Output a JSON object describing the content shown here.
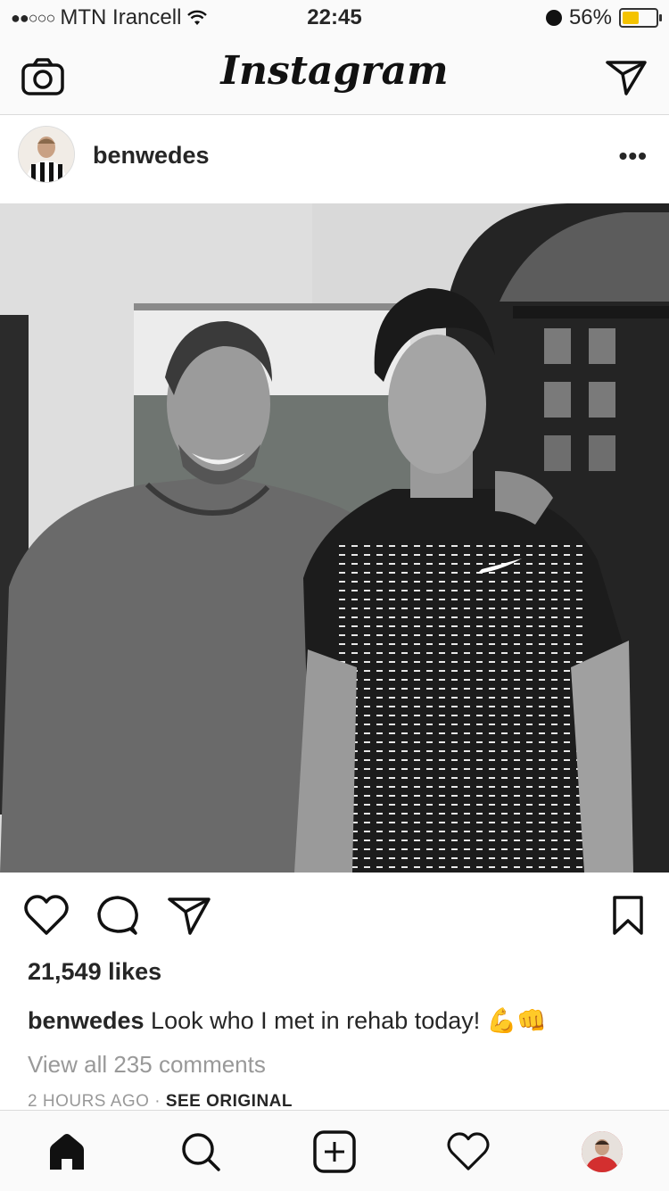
{
  "status": {
    "signal_dots": "●●○○○",
    "carrier": "MTN Irancell",
    "time": "22:45",
    "battery_pct": "56%",
    "battery_level": 0.56
  },
  "header": {
    "logo": "Instagram",
    "camera_icon": "camera-icon",
    "direct_icon": "paper-plane-icon"
  },
  "post": {
    "username": "benwedes",
    "more_label": "•••",
    "likes": "21,549 likes",
    "caption_user": "benwedes",
    "caption_text": " Look who I met in rehab today! 💪👊",
    "view_comments": "View all 235 comments",
    "time_ago": "2 HOURS AGO",
    "separator": " · ",
    "see_original": "SEE ORIGINAL"
  },
  "tabs": [
    "home-icon",
    "search-icon",
    "add-icon",
    "heart-icon",
    "profile-avatar"
  ]
}
